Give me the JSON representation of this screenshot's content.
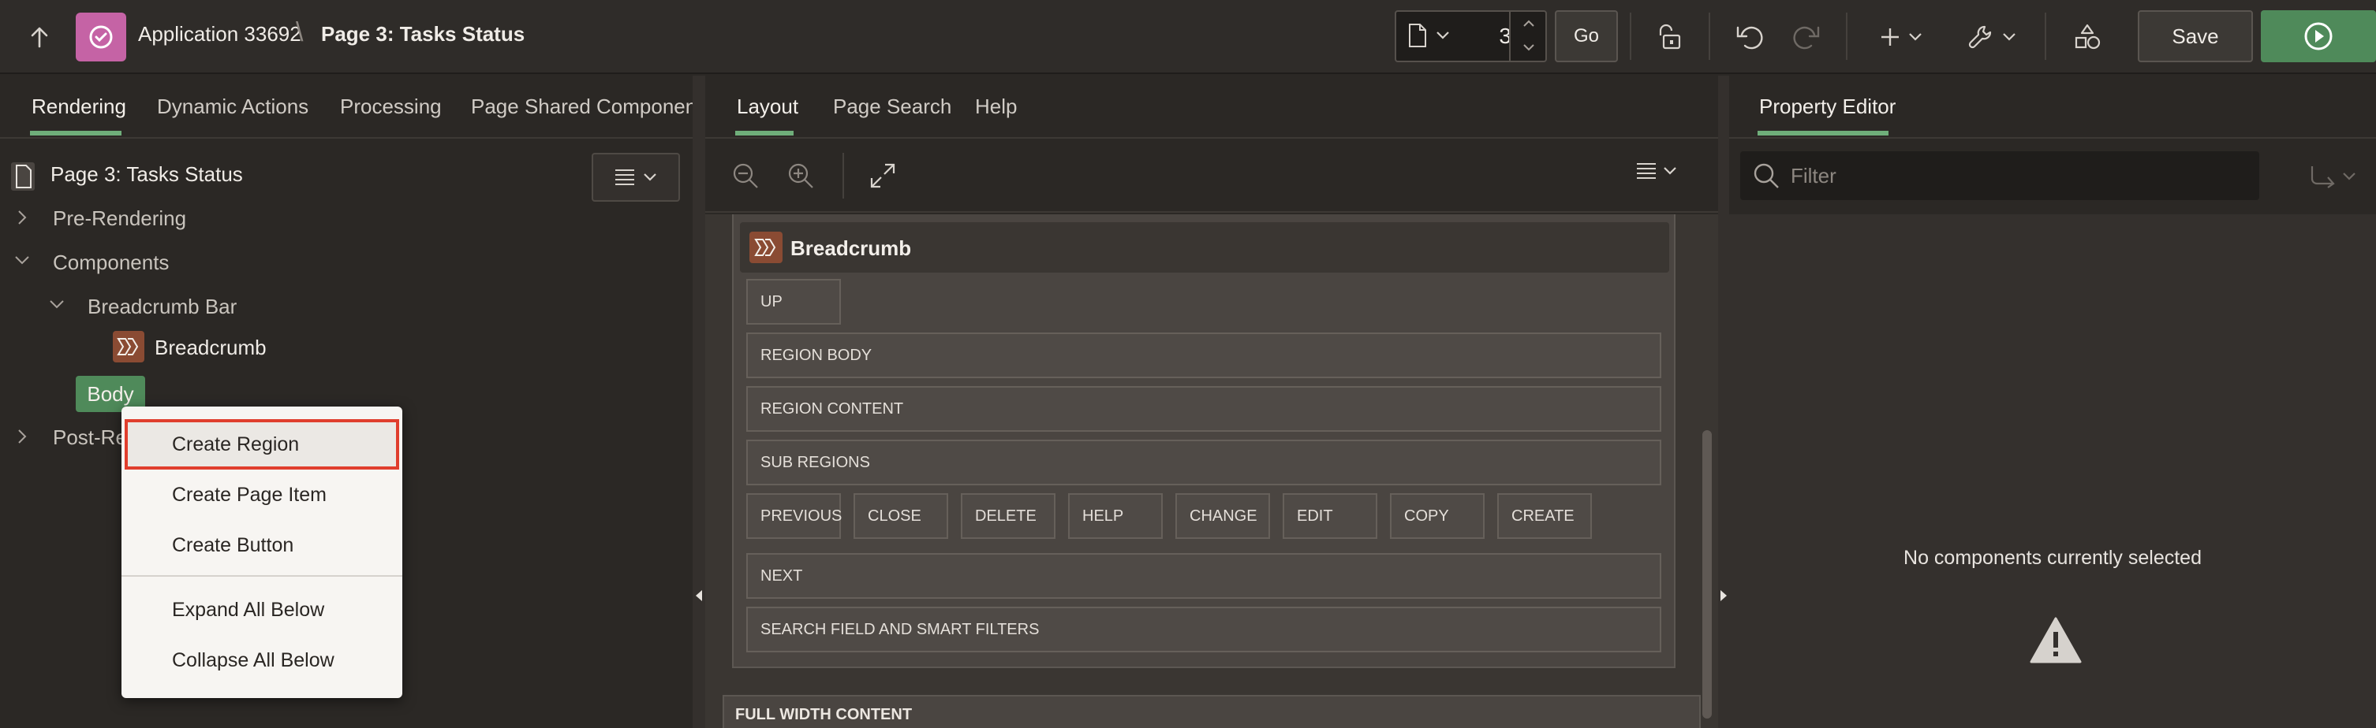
{
  "topbar": {
    "app_title": "Application 33692",
    "separator": "\\",
    "page_title": "Page 3: Tasks Status",
    "page_number": "3",
    "go_label": "Go",
    "save_label": "Save"
  },
  "left_panel": {
    "tabs": [
      {
        "label": "Rendering",
        "active": true
      },
      {
        "label": "Dynamic Actions",
        "active": false
      },
      {
        "label": "Processing",
        "active": false
      },
      {
        "label": "Page Shared Components",
        "active": false
      }
    ],
    "tree": {
      "root": "Page 3: Tasks Status",
      "pre_rendering": "Pre-Rendering",
      "components": "Components",
      "breadcrumb_bar": "Breadcrumb Bar",
      "breadcrumb": "Breadcrumb",
      "body": "Body",
      "post_rendering_partial": "Post-Re"
    },
    "context_menu": [
      {
        "label": "Create Region",
        "highlighted": true
      },
      {
        "label": "Create Page Item"
      },
      {
        "label": "Create Button"
      },
      {
        "label": "Expand All Below"
      },
      {
        "label": "Collapse All Below"
      }
    ]
  },
  "middle_panel": {
    "tabs": [
      {
        "label": "Layout",
        "active": true
      },
      {
        "label": "Page Search",
        "active": false
      },
      {
        "label": "Help",
        "active": false
      }
    ],
    "region_title": "Breadcrumb",
    "slots": {
      "up": "UP",
      "region_body": "REGION BODY",
      "region_content": "REGION CONTENT",
      "sub_regions": "SUB REGIONS",
      "buttons": [
        "PREVIOUS",
        "CLOSE",
        "DELETE",
        "HELP",
        "CHANGE",
        "EDIT",
        "COPY",
        "CREATE"
      ],
      "next": "NEXT",
      "search_field": "SEARCH FIELD AND SMART FILTERS"
    },
    "full_width_content": "FULL WIDTH CONTENT"
  },
  "right_panel": {
    "tab": "Property Editor",
    "filter_placeholder": "Filter",
    "empty_message": "No components currently selected"
  },
  "colors": {
    "accent_green": "#4f8a5a",
    "tab_underline": "#6fae7a",
    "app_icon": "#c563a5",
    "breadcrumb_icon": "#8a4b33",
    "highlight_border": "#e03e2d"
  }
}
